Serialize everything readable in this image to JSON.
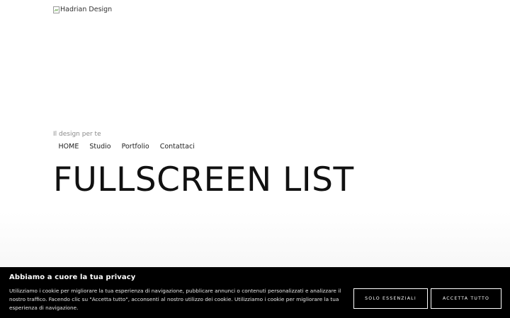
{
  "header": {
    "logo_alt": "Hadrian Design",
    "tagline": "Il design per te"
  },
  "nav": {
    "items": [
      {
        "label": "HOME"
      },
      {
        "label": "Studio"
      },
      {
        "label": "Portfolio"
      },
      {
        "label": "Contattaci"
      }
    ]
  },
  "main": {
    "title": "FULLSCREEN LIST"
  },
  "cookie_banner": {
    "title": "Abbiamo a cuore la tua privacy",
    "text": "Utilizziamo i cookie per migliorare la tua esperienza di navigazione, pubblicare annunci o contenuti personalizzati e analizzare il nostro traffico. Facendo clic su \"Accetta tutto\", acconsenti al nostro utilizzo dei cookie. Utilizziamo i cookie per migliorare la tua esperienza di navigazione.",
    "essential_label": "SOLO ESSENZIALI",
    "accept_label": "ACCETTA TUTTO"
  },
  "colors": {
    "banner_bg": "#000000",
    "banner_text": "#ffffff",
    "tagline": "#8a8a8a"
  }
}
